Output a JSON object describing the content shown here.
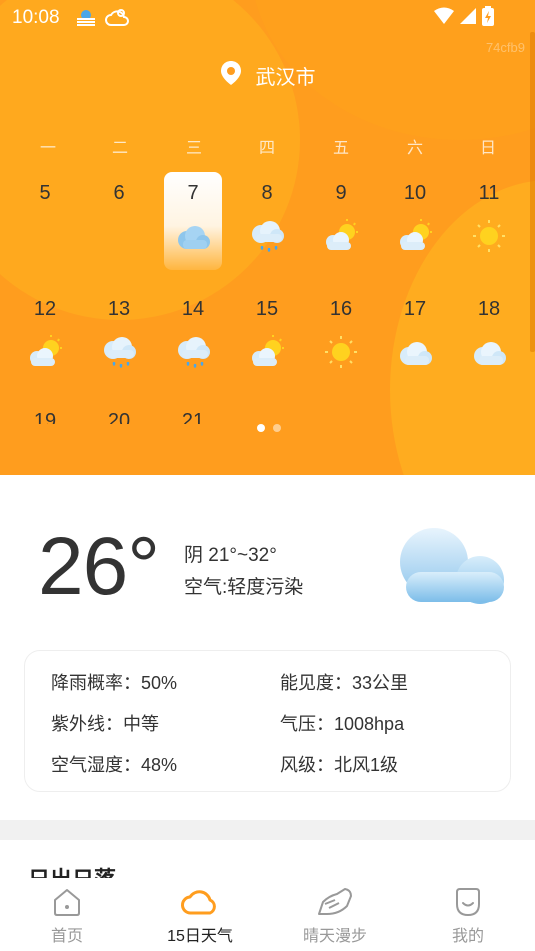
{
  "status_bar": {
    "time": "10:08",
    "watermark": "74cfb9"
  },
  "location": {
    "city": "武汉市"
  },
  "calendar": {
    "weekdays": [
      "一",
      "二",
      "三",
      "四",
      "五",
      "六",
      "日"
    ],
    "days": [
      {
        "day": "5",
        "icon": ""
      },
      {
        "day": "6",
        "icon": ""
      },
      {
        "day": "7",
        "icon": "cloudy-icon",
        "selected": true
      },
      {
        "day": "8",
        "icon": "rain-icon"
      },
      {
        "day": "9",
        "icon": "partly-sunny-icon"
      },
      {
        "day": "10",
        "icon": "partly-sunny-icon"
      },
      {
        "day": "11",
        "icon": "sunny-icon"
      },
      {
        "day": "12",
        "icon": "partly-sunny-icon"
      },
      {
        "day": "13",
        "icon": "rain-icon"
      },
      {
        "day": "14",
        "icon": "rain-icon"
      },
      {
        "day": "15",
        "icon": "partly-sunny-icon"
      },
      {
        "day": "16",
        "icon": "sunny-icon"
      },
      {
        "day": "17",
        "icon": "cloudy-icon"
      },
      {
        "day": "18",
        "icon": "cloudy-icon"
      }
    ],
    "next_row_partial": [
      "19",
      "20",
      "21"
    ],
    "page_count": 2,
    "active_page": 0
  },
  "current": {
    "temperature": "26°",
    "condition_range": "阴 21°~32°",
    "air_quality": "空气:轻度污染"
  },
  "details": {
    "rain_prob": "降雨概率：50%",
    "visibility": "能见度：33公里",
    "uv": "紫外线：中等",
    "pressure": "气压：1008hpa",
    "humidity": "空气湿度：48%",
    "wind": "风级：北风1级"
  },
  "section": {
    "sunrise_title": "日出日落"
  },
  "nav": [
    {
      "label": "首页",
      "icon": "home-icon"
    },
    {
      "label": "15日天气",
      "icon": "cloud-icon",
      "active": true
    },
    {
      "label": "晴天漫步",
      "icon": "shoe-icon"
    },
    {
      "label": "我的",
      "icon": "smile-icon"
    }
  ],
  "colors": {
    "accent": "#ff9d1e",
    "accent_light": "#ffb21f",
    "text": "#333333",
    "muted": "#999999"
  }
}
